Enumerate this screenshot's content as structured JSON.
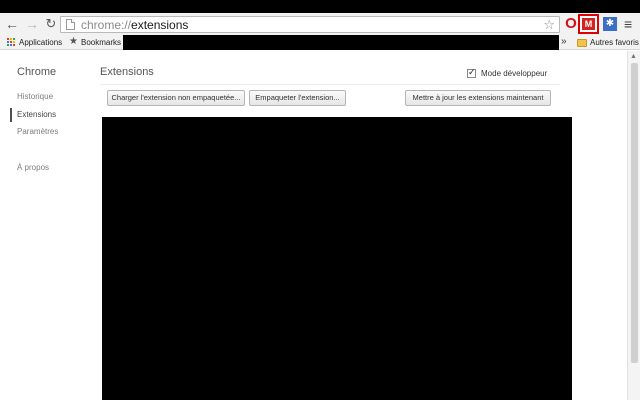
{
  "browser": {
    "url_scheme": "chrome://",
    "url_path": "extensions",
    "bookmarks": {
      "apps_label": "Applications",
      "bookmark_label": "Bookmarks",
      "overflow": "»",
      "other_label": "Autres favoris"
    },
    "icons": {
      "back": "back-arrow-icon",
      "forward": "forward-arrow-icon",
      "reload": "reload-icon",
      "star": "star-icon",
      "opera_ext": "opera-extension-icon",
      "highlighted_ext": "red-extension-icon",
      "puzzle_ext": "puzzle-extension-icon",
      "menu": "hamburger-menu-icon"
    }
  },
  "sidebar": {
    "title": "Chrome",
    "items": [
      {
        "label": "Historique"
      },
      {
        "label": "Extensions"
      },
      {
        "label": "Paramètres"
      },
      {
        "label": "À propos"
      }
    ]
  },
  "main": {
    "title": "Extensions",
    "dev_mode_label": "Mode développeur",
    "dev_mode_checked": true,
    "buttons": {
      "load": "Charger l'extension non empaquetée...",
      "pack": "Empaqueter l'extension...",
      "update": "Mettre à jour les extensions maintenant"
    }
  },
  "colors": {
    "highlight_border": "#e00000",
    "toolbar_bg": "#f2f2f2"
  }
}
